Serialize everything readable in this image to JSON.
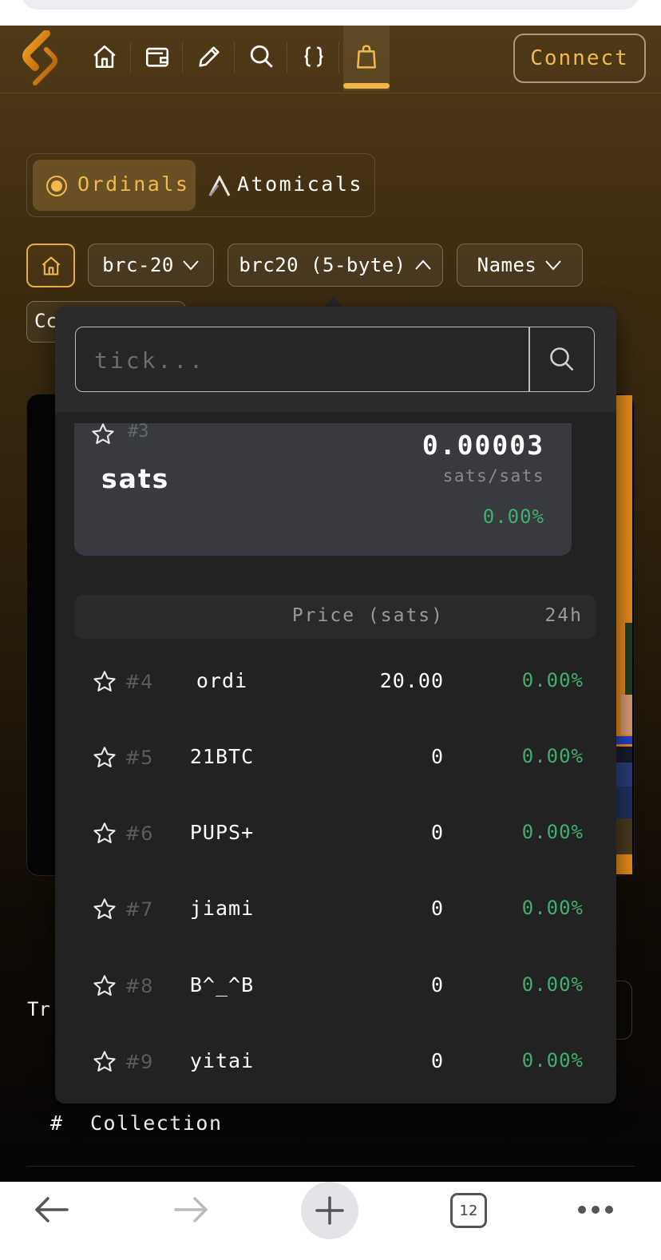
{
  "nav": {
    "icons": [
      "home-icon",
      "wallet-icon",
      "pencil-icon",
      "search-icon",
      "braces-icon",
      "shopping-bag-icon"
    ],
    "active_icon": "shopping-bag-icon",
    "connect_label": "Connect"
  },
  "protocols": {
    "items": [
      {
        "label": "Ordinals",
        "active": true
      },
      {
        "label": "Atomicals",
        "active": false
      }
    ]
  },
  "filters": {
    "chips": [
      {
        "label": "brc-20",
        "chevron": "down"
      },
      {
        "label": "brc20 (5-byte)",
        "chevron": "up"
      },
      {
        "label": "Names",
        "chevron": "down"
      }
    ],
    "partial_chip_label": "Cc"
  },
  "dropdown": {
    "search_placeholder": "tick...",
    "featured": {
      "rank": "#3",
      "name": "sats",
      "price": "0.00003",
      "unit": "sats/sats",
      "change": "0.00%"
    },
    "table": {
      "price_header": "Price (sats)",
      "change_header": "24h",
      "rows": [
        {
          "rank": "#4",
          "name": "ordi",
          "price": "20.00",
          "change": "0.00%"
        },
        {
          "rank": "#5",
          "name": "21BTC",
          "price": "0",
          "change": "0.00%"
        },
        {
          "rank": "#6",
          "name": "PUPS+",
          "price": "0",
          "change": "0.00%"
        },
        {
          "rank": "#7",
          "name": "jiami",
          "price": "0",
          "change": "0.00%"
        },
        {
          "rank": "#8",
          "name": "B^_^B",
          "price": "0",
          "change": "0.00%"
        },
        {
          "rank": "#9",
          "name": "yitai",
          "price": "0",
          "change": "0.00%"
        }
      ]
    }
  },
  "background": {
    "partial_text": "Tr",
    "table_hash": "#",
    "table_collection": "Collection"
  },
  "browser": {
    "tab_count": "12"
  },
  "colors": {
    "accent": "#f3b84e",
    "positive": "#3fae6e",
    "dropdown_bg": "#222222"
  }
}
